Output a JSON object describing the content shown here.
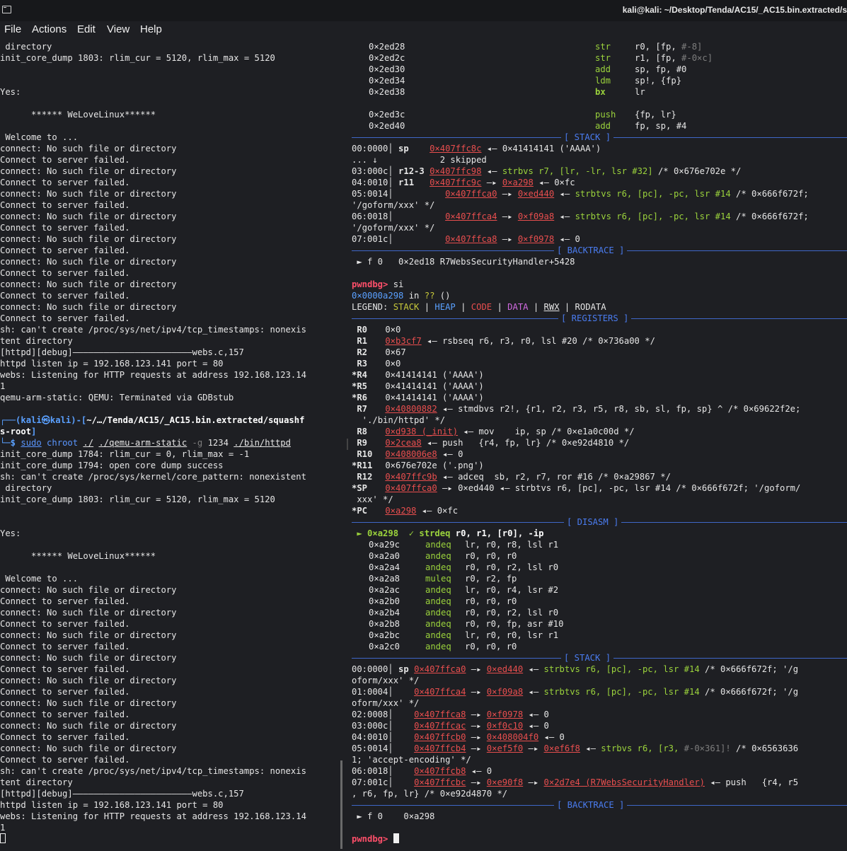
{
  "window": {
    "title": "kali@kali: ~/Desktop/Tenda/AC15/_AC15.bin.extracted/s"
  },
  "menu": [
    "File",
    "Actions",
    "Edit",
    "View",
    "Help"
  ],
  "left": {
    "l01": " directory",
    "l02": "init_core_dump 1803: rlim_cur = 5120, rlim_max = 5120",
    "l03": "Yes:",
    "l04": "      ****** WeLoveLinux******",
    "l05": " Welcome to ...",
    "nsf": "connect: No such file or directory",
    "csf": "Connect to server failed.",
    "tcp1": "sh: can't create /proc/sys/net/ipv4/tcp_timestamps: nonexis",
    "tcp2": "tent directory",
    "dbg": "[httpd][debug]———————————————————————webs.c,157",
    "ip": "httpd listen ip = 192.168.123.141 port = 80",
    "webs1": "webs: Listening for HTTP requests at address 192.168.123.14",
    "webs2": "1",
    "qemu": "qemu-arm-static: QEMU: Terminated via GDBstub",
    "p_open": "┌──(",
    "p_user": "kali㉿kali",
    "p_mid": ")-[",
    "p_path1": "~/…/Tenda/AC15/_AC15.bin.extracted/squashf",
    "p_path2": "s-root",
    "p_close": "]",
    "p_dollar": "└─$ ",
    "c_sudo": "sudo",
    "c_chroot": " chroot ",
    "c_dot": "./",
    "c_qemu": "./qemu-arm-static",
    "c_g": " -g ",
    "c_port": "1234 ",
    "c_bin": "./bin/httpd",
    "r1": "init_core_dump 1784: rlim_cur = 0, rlim_max = -1",
    "r2": "init_core_dump 1794: open core dump success",
    "r3": "sh: can't create /proc/sys/kernel/core_pattern: nonexistent",
    "r4": " directory",
    "r5": "init_core_dump 1803: rlim_cur = 5120, rlim_max = 5120"
  },
  "right": {
    "disasm_top": [
      {
        "addr": "0×2ed28",
        "op": "str",
        "args": "r0, [fp, ",
        "tail": "#-8]"
      },
      {
        "addr": "0×2ed2c",
        "op": "str",
        "args": "r1, [fp, ",
        "tail": "#-0×c]"
      },
      {
        "addr": "0×2ed30",
        "op": "add",
        "args": "sp, fp, #0",
        "tail": ""
      },
      {
        "addr": "0×2ed34",
        "op": "ldm",
        "args": "sp!, {fp}",
        "tail": ""
      },
      {
        "addr": "0×2ed38",
        "op": "bx",
        "args": "lr",
        "tail": ""
      },
      {
        "addr": "0×2ed3c",
        "op": "push",
        "args": "{fp, lr}",
        "tail": ""
      },
      {
        "addr": "0×2ed40",
        "op": "add",
        "args": "fp, sp, #4",
        "tail": ""
      }
    ],
    "sec_stack": "[ STACK ]",
    "sec_backtrace": "[ BACKTRACE ]",
    "sec_registers": "[ REGISTERS ]",
    "sec_disasm": "[ DISASM ]",
    "s1": {
      "a_idx": "00:0000│ ",
      "a_reg": "sp",
      "a_addr": "0×407ffc8c",
      "a_rest": " ◂— 0×41414141 ('AAAA')",
      "skip": "... ↓            2 skipped",
      "b_idx": "03:000c│ ",
      "b_reg": "r12-3",
      "b_addr": "0×407ffc98",
      "b_ins": "strbvs r7, [lr, -lr, lsr #32]",
      "b_cmt": " /* 0×676e702e */",
      "c_idx": "04:0010│ ",
      "c_reg": "r11",
      "c_addr": "0×407ffc9c",
      "c_ptr": "0×a298",
      "c_rest": " ◂— 0×fc",
      "d_idx": "05:0014│ ",
      "d_addr": "0×407ffca0",
      "d_ptr": "0×ed440",
      "d_ins": "strbtvs r6, [pc], -pc, lsr #14",
      "d_cmt": " /* 0×666f672f;",
      "d_cont": "'/goform/xxx' */",
      "e_idx": "06:0018│ ",
      "e_addr": "0×407ffca4",
      "e_ptr": "0×f09a8",
      "e_ins": "strbtvs r6, [pc], -pc, lsr #14",
      "e_cmt": " /* 0×666f672f;",
      "e_cont": "'/goform/xxx' */",
      "f_idx": "07:001c│ ",
      "f_addr": "0×407ffca8",
      "f_ptr": "0×f0978",
      "f_rest": " ◂— 0"
    },
    "bt1": " ► f 0   0×2ed18 R7WebsSecurityHandler+5428",
    "pwndbg": "pwndbg>",
    "cmd": " si",
    "si_addr": "0×0000a298",
    "si_in": " in ",
    "si_q": "??",
    "si_paren": " ()",
    "legend": [
      "LEGEND: ",
      "STACK",
      " | ",
      "HEAP",
      " | ",
      "CODE",
      " | ",
      "DATA",
      " | ",
      "RWX",
      " | RODATA"
    ],
    "regs": [
      {
        "mark": " ",
        "name": "R0",
        "val": "0×0",
        "ptr": "",
        "rest": ""
      },
      {
        "mark": " ",
        "name": "R1",
        "val": "",
        "ptr": "0×b3cf7",
        "rest": " ◂— rsbseq r6, r3, r0, lsl #20 /* 0×736a00 */"
      },
      {
        "mark": " ",
        "name": "R2",
        "val": "0×67",
        "ptr": "",
        "rest": ""
      },
      {
        "mark": " ",
        "name": "R3",
        "val": "0×0",
        "ptr": "",
        "rest": ""
      },
      {
        "mark": "*",
        "name": "R4",
        "val": "0×41414141 ('AAAA')",
        "ptr": "",
        "rest": ""
      },
      {
        "mark": "*",
        "name": "R5",
        "val": "0×41414141 ('AAAA')",
        "ptr": "",
        "rest": ""
      },
      {
        "mark": "*",
        "name": "R6",
        "val": "0×41414141 ('AAAA')",
        "ptr": "",
        "rest": ""
      },
      {
        "mark": " ",
        "name": "R7",
        "val": "",
        "ptr": "0×40800882",
        "rest": " ◂— stmdbvs r2!, {r1, r2, r3, r5, r8, sb, sl, fp, sp} ^ /* 0×69622f2e;"
      },
      {
        "mark": " ",
        "name": "",
        "val": " './bin/httpd' */",
        "ptr": "",
        "rest": ""
      },
      {
        "mark": " ",
        "name": "R8",
        "val": "",
        "ptr": "0×d938 (_init)",
        "rest": " ◂— mov    ip, sp /* 0×e1a0c00d */"
      },
      {
        "mark": " ",
        "name": "R9",
        "val": "",
        "ptr": "0×2cea8",
        "rest": " ◂— push   {r4, fp, lr} /* 0×e92d4810 */"
      },
      {
        "mark": " ",
        "name": "R10",
        "val": "",
        "ptr": "0×408006e8",
        "rest": " ◂— 0"
      },
      {
        "mark": "*",
        "name": "R11",
        "val": "0×676e702e ('.png')",
        "ptr": "",
        "rest": ""
      },
      {
        "mark": " ",
        "name": "R12",
        "val": "",
        "ptr": "0×407ffc9b",
        "rest": " ◂— adceq  sb, r2, r7, ror #16 /* 0×a29867 */"
      },
      {
        "mark": "*",
        "name": "SP",
        "val": "",
        "ptr": "0×407ffca0",
        "rest": " —▸ 0×ed440 ◂— strbtvs r6, [pc], -pc, lsr #14 /* 0×666f672f; '/goform/"
      },
      {
        "mark": " ",
        "name": "",
        "val": "xxx' */",
        "ptr": "",
        "rest": ""
      },
      {
        "mark": "*",
        "name": "PC",
        "val": "",
        "ptr": "0×a298",
        "rest": " ◂— 0×fc"
      }
    ],
    "disasm_cur": {
      "arrow": " ► ",
      "addr": "0×a298",
      "check": "  ✓ ",
      "op": "strdeq",
      "args": " r0, r1, [r0], -ip"
    },
    "disasm": [
      {
        "addr": "0×a29c",
        "op": "andeq",
        "args": "lr, r0, r8, lsl r1"
      },
      {
        "addr": "0×a2a0",
        "op": "andeq",
        "args": "r0, r0, r0"
      },
      {
        "addr": "0×a2a4",
        "op": "andeq",
        "args": "r0, r0, r2, lsl r0"
      },
      {
        "addr": "0×a2a8",
        "op": "muleq",
        "args": "r0, r2, fp"
      },
      {
        "addr": "0×a2ac",
        "op": "andeq",
        "args": "lr, r0, r4, lsr #2"
      },
      {
        "addr": "0×a2b0",
        "op": "andeq",
        "args": "r0, r0, r0"
      },
      {
        "addr": "0×a2b4",
        "op": "andeq",
        "args": "r0, r0, r2, lsl r0"
      },
      {
        "addr": "0×a2b8",
        "op": "andeq",
        "args": "r0, r0, fp, asr #10"
      },
      {
        "addr": "0×a2bc",
        "op": "andeq",
        "args": "lr, r0, r0, lsr r1"
      },
      {
        "addr": "0×a2c0",
        "op": "andeq",
        "args": "r0, r0, r0"
      }
    ],
    "s2": {
      "a": "00:0000│ ",
      "a_sp": "sp ",
      "a_addr": "0×407ffca0",
      "a_ptr": "0×ed440",
      "a_ins": "strbtvs r6, [pc], -pc, lsr #14",
      "a_cmt": " /* 0×666f672f; '/g",
      "a_cont": "oform/xxx' */",
      "b": "01:0004│    ",
      "b_addr": "0×407ffca4",
      "b_ptr": "0×f09a8",
      "b_ins": "strbtvs r6, [pc], -pc, lsr #14",
      "b_cmt": " /* 0×666f672f; '/g",
      "b_cont": "oform/xxx' */",
      "c": "02:0008│    ",
      "c_addr": "0×407ffca8",
      "c_ptr": "0×f0978",
      "c_rest": " ◂— 0",
      "d": "03:000c│    ",
      "d_addr": "0×407ffcac",
      "d_ptr": "0×f0c10",
      "d_rest": " ◂— 0",
      "e": "04:0010│    ",
      "e_addr": "0×407ffcb0",
      "e_ptr": "0×408004f0",
      "e_rest": " ◂— 0",
      "f": "05:0014│    ",
      "f_addr": "0×407ffcb4",
      "f_ptr": "0×ef5f0",
      "f_ptr2": "0×ef6f8",
      "f_ins": "strbvs r6, [r3, ",
      "f_imm": "#-0×361]!",
      "f_cmt": " /* 0×6563636",
      "f_cont": "1; 'accept-encoding' */",
      "g": "06:0018│    ",
      "g_addr": "0×407ffcb8",
      "g_rest": " ◂— 0",
      "h": "07:001c│    ",
      "h_addr": "0×407ffcbc",
      "h_ptr": "0×e90f8",
      "h_ptr2": "0×2d7e4 (R7WebsSecurityHandler)",
      "h_ins": " ◂— push   {r4, r5",
      "h_cont": ", r6, fp, lr} /* 0×e92d4870 */"
    },
    "bt2": " ► f 0    0×a298"
  }
}
